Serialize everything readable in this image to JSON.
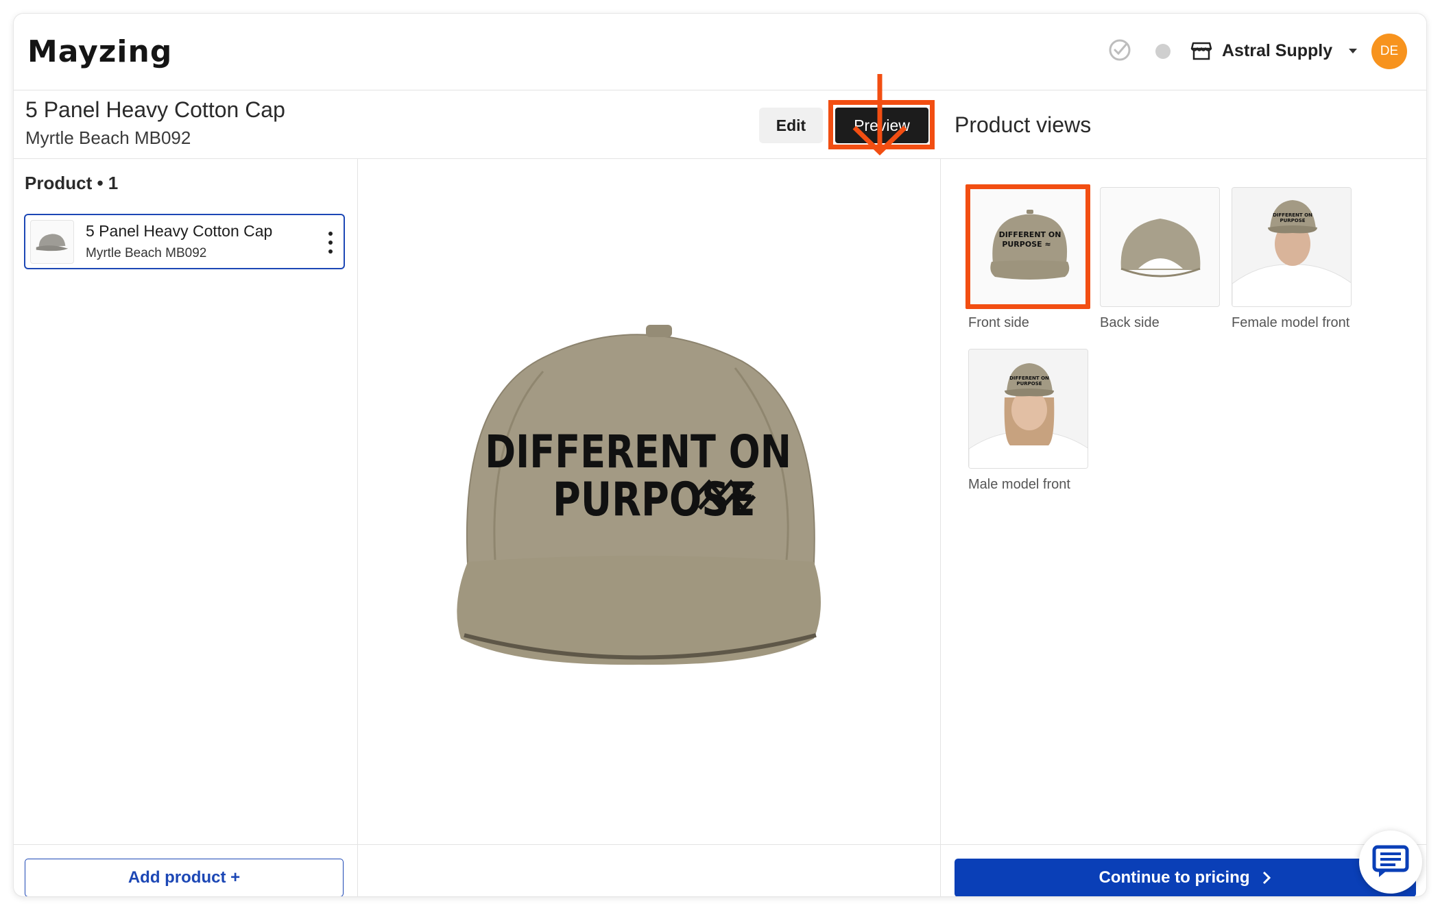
{
  "app": {
    "logo": "Mayzing"
  },
  "topbar": {
    "store_name": "Astral Supply",
    "avatar_initials": "DE"
  },
  "header": {
    "title": "5 Panel Heavy Cotton Cap",
    "subtitle": "Myrtle Beach MB092",
    "edit_label": "Edit",
    "preview_label": "Preview"
  },
  "left": {
    "product_count_label": "Product • 1",
    "items": [
      {
        "name": "5 Panel Heavy Cotton Cap",
        "sub": "Myrtle Beach MB092"
      }
    ],
    "add_product_label": "Add product  +"
  },
  "canvas": {
    "print_text_line1": "DIFFERENT ON",
    "print_text_line2": "PURPOSE"
  },
  "right": {
    "title": "Product views",
    "views": [
      {
        "label": "Front side",
        "selected": true
      },
      {
        "label": "Back side",
        "selected": false
      },
      {
        "label": "Female model front",
        "selected": false
      },
      {
        "label": "Male model front",
        "selected": false
      }
    ],
    "continue_label": "Continue to pricing"
  },
  "colors": {
    "accent_blue": "#0a3fb7",
    "highlight_orange": "#f24e12",
    "cap_khaki": "#9e957f",
    "avatar_orange": "#f7931e"
  }
}
